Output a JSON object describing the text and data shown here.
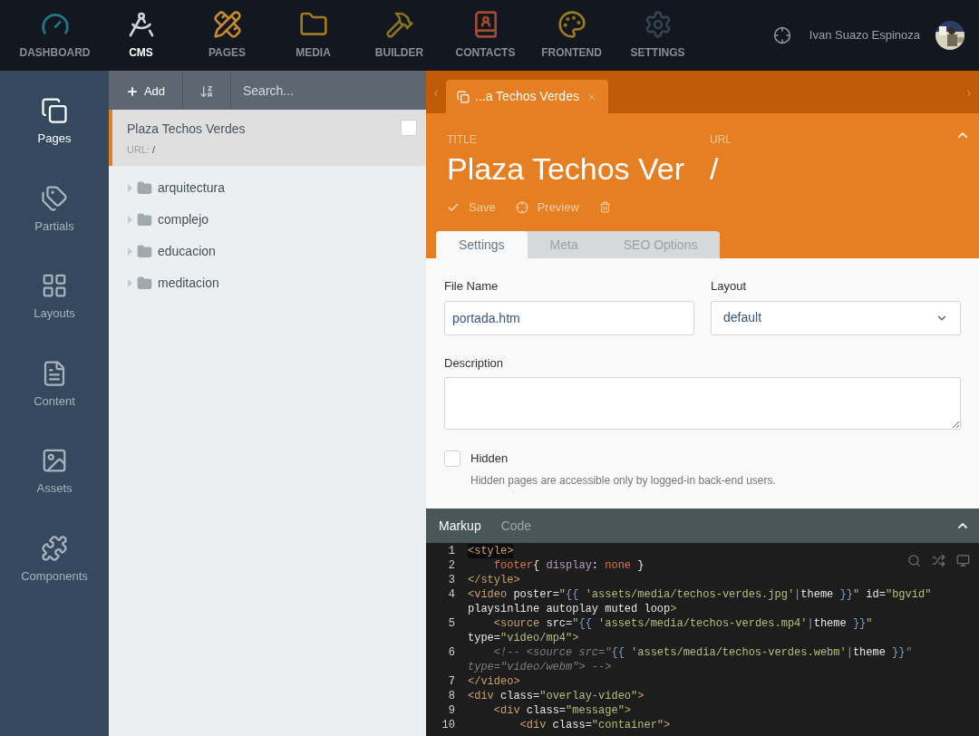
{
  "top_nav": {
    "items": [
      {
        "label": "DASHBOARD",
        "kind": "dashboard",
        "selected": false
      },
      {
        "label": "CMS",
        "kind": "cms",
        "selected": true
      },
      {
        "label": "PAGES",
        "kind": "pages",
        "selected": false
      },
      {
        "label": "MEDIA",
        "kind": "media",
        "selected": false
      },
      {
        "label": "BUILDER",
        "kind": "builder",
        "selected": false
      },
      {
        "label": "CONTACTS",
        "kind": "contacts",
        "selected": false
      },
      {
        "label": "FRONTEND",
        "kind": "frontend",
        "selected": false
      },
      {
        "label": "SETTINGS",
        "kind": "settings",
        "selected": false
      }
    ],
    "user_name": "Ivan Suazo Espinoza"
  },
  "sidebar": {
    "items": [
      {
        "label": "Pages",
        "kind": "pages",
        "selected": true
      },
      {
        "label": "Partials",
        "kind": "partials",
        "selected": false
      },
      {
        "label": "Layouts",
        "kind": "layouts",
        "selected": false
      },
      {
        "label": "Content",
        "kind": "content",
        "selected": false
      },
      {
        "label": "Assets",
        "kind": "assets",
        "selected": false
      },
      {
        "label": "Components",
        "kind": "components",
        "selected": false
      }
    ]
  },
  "list_panel": {
    "add_label": "Add",
    "search_placeholder": "Search...",
    "page": {
      "title": "Plaza Techos Verdes",
      "url_label": "URL:",
      "url": "/",
      "selected": true,
      "checked": false
    },
    "folders": [
      {
        "name": "arquitectura",
        "expanded": false
      },
      {
        "name": "complejo",
        "expanded": false
      },
      {
        "name": "educacion",
        "expanded": false
      },
      {
        "name": "meditacion",
        "expanded": false
      }
    ]
  },
  "editor": {
    "open_tab": {
      "label": "...a Techos Verdes"
    },
    "title_label": "TITLE",
    "title": "Plaza Techos Ver",
    "url_label": "URL",
    "url": "/",
    "actions": [
      "Save",
      "Preview"
    ],
    "tabs": [
      {
        "label": "Settings",
        "selected": true
      },
      {
        "label": "Meta",
        "selected": false
      },
      {
        "label": "SEO Options",
        "selected": false
      }
    ],
    "file_name": {
      "label": "File Name",
      "value": "portada.htm"
    },
    "layout": {
      "label": "Layout",
      "value": "default"
    },
    "description": {
      "label": "Description"
    },
    "hidden": {
      "label": "Hidden",
      "checked": false,
      "help": "Hidden pages are accessible only by logged-in back-end users."
    }
  },
  "code": {
    "tabs": [
      {
        "label": "Markup",
        "selected": true
      },
      {
        "label": "Code",
        "selected": false
      }
    ],
    "lines": [
      {
        "number": "1",
        "active": true,
        "tokens": [
          {
            "kind": "tag",
            "text": "<style>"
          }
        ]
      },
      {
        "number": "2",
        "active": false,
        "tokens": [
          {
            "kind": "sel",
            "text": "    footer"
          },
          {
            "kind": "plain",
            "text": "{ "
          },
          {
            "kind": "prop",
            "text": "display"
          },
          {
            "kind": "plain",
            "text": ": "
          },
          {
            "kind": "val",
            "text": "none"
          },
          {
            "kind": "plain",
            "text": " }"
          }
        ]
      },
      {
        "number": "3",
        "active": false,
        "tokens": [
          {
            "kind": "tag",
            "text": "</style>"
          }
        ]
      },
      {
        "number": "4",
        "active": false,
        "tokens": [
          {
            "kind": "tag",
            "text": "<video"
          },
          {
            "kind": "attr",
            "text": " poster"
          },
          {
            "kind": "plain",
            "text": "="
          },
          {
            "kind": "str",
            "text": "\""
          },
          {
            "kind": "brace",
            "text": "{{"
          },
          {
            "kind": "str",
            "text": " 'assets/media/techos-verdes.jpg'"
          },
          {
            "kind": "pipe",
            "text": "|"
          },
          {
            "kind": "plain",
            "text": "theme"
          },
          {
            "kind": "brace",
            "text": " }}"
          },
          {
            "kind": "str",
            "text": "\""
          },
          {
            "kind": "attr",
            "text": " id"
          },
          {
            "kind": "plain",
            "text": "="
          },
          {
            "kind": "str",
            "text": "\"bgvid\""
          },
          {
            "kind": "attr",
            "text": " playsinline autoplay muted loop"
          },
          {
            "kind": "tag",
            "text": ">"
          }
        ]
      },
      {
        "number": "5",
        "active": false,
        "tokens": [
          {
            "kind": "tag",
            "text": "    <source"
          },
          {
            "kind": "attr",
            "text": " src"
          },
          {
            "kind": "plain",
            "text": "="
          },
          {
            "kind": "str",
            "text": "\""
          },
          {
            "kind": "brace",
            "text": "{{"
          },
          {
            "kind": "str",
            "text": " 'assets/media/techos-verdes.mp4'"
          },
          {
            "kind": "pipe",
            "text": "|"
          },
          {
            "kind": "plain",
            "text": "theme"
          },
          {
            "kind": "brace",
            "text": " }}"
          },
          {
            "kind": "str",
            "text": "\""
          },
          {
            "kind": "attr",
            "text": " type"
          },
          {
            "kind": "plain",
            "text": "="
          },
          {
            "kind": "str",
            "text": "\"video/mp4\""
          },
          {
            "kind": "tag",
            "text": ">"
          }
        ]
      },
      {
        "number": "6",
        "active": false,
        "tokens": [
          {
            "kind": "comment",
            "text": "    <!-- <source src=\""
          },
          {
            "kind": "brace",
            "text": "{{"
          },
          {
            "kind": "str",
            "text": " 'assets/media/techos-verdes.webm'"
          },
          {
            "kind": "pipe",
            "text": "|"
          },
          {
            "kind": "plain",
            "text": "theme"
          },
          {
            "kind": "brace",
            "text": " }}"
          },
          {
            "kind": "comment",
            "text": "\" type=\"video/webm\"> -->"
          }
        ]
      },
      {
        "number": "7",
        "active": false,
        "tokens": [
          {
            "kind": "tag",
            "text": "</video>"
          }
        ]
      },
      {
        "number": "8",
        "active": false,
        "tokens": [
          {
            "kind": "tag",
            "text": "<div"
          },
          {
            "kind": "attr",
            "text": " class"
          },
          {
            "kind": "plain",
            "text": "="
          },
          {
            "kind": "str",
            "text": "\"overlay-video\""
          },
          {
            "kind": "tag",
            "text": ">"
          }
        ]
      },
      {
        "number": "9",
        "active": false,
        "tokens": [
          {
            "kind": "tag",
            "text": "    <div"
          },
          {
            "kind": "attr",
            "text": " class"
          },
          {
            "kind": "plain",
            "text": "="
          },
          {
            "kind": "str",
            "text": "\"message\""
          },
          {
            "kind": "tag",
            "text": ">"
          }
        ]
      },
      {
        "number": "10",
        "active": false,
        "tokens": [
          {
            "kind": "tag",
            "text": "        <div"
          },
          {
            "kind": "attr",
            "text": " class"
          },
          {
            "kind": "plain",
            "text": "="
          },
          {
            "kind": "str",
            "text": "\"container\""
          },
          {
            "kind": "tag",
            "text": ">"
          }
        ]
      }
    ]
  }
}
